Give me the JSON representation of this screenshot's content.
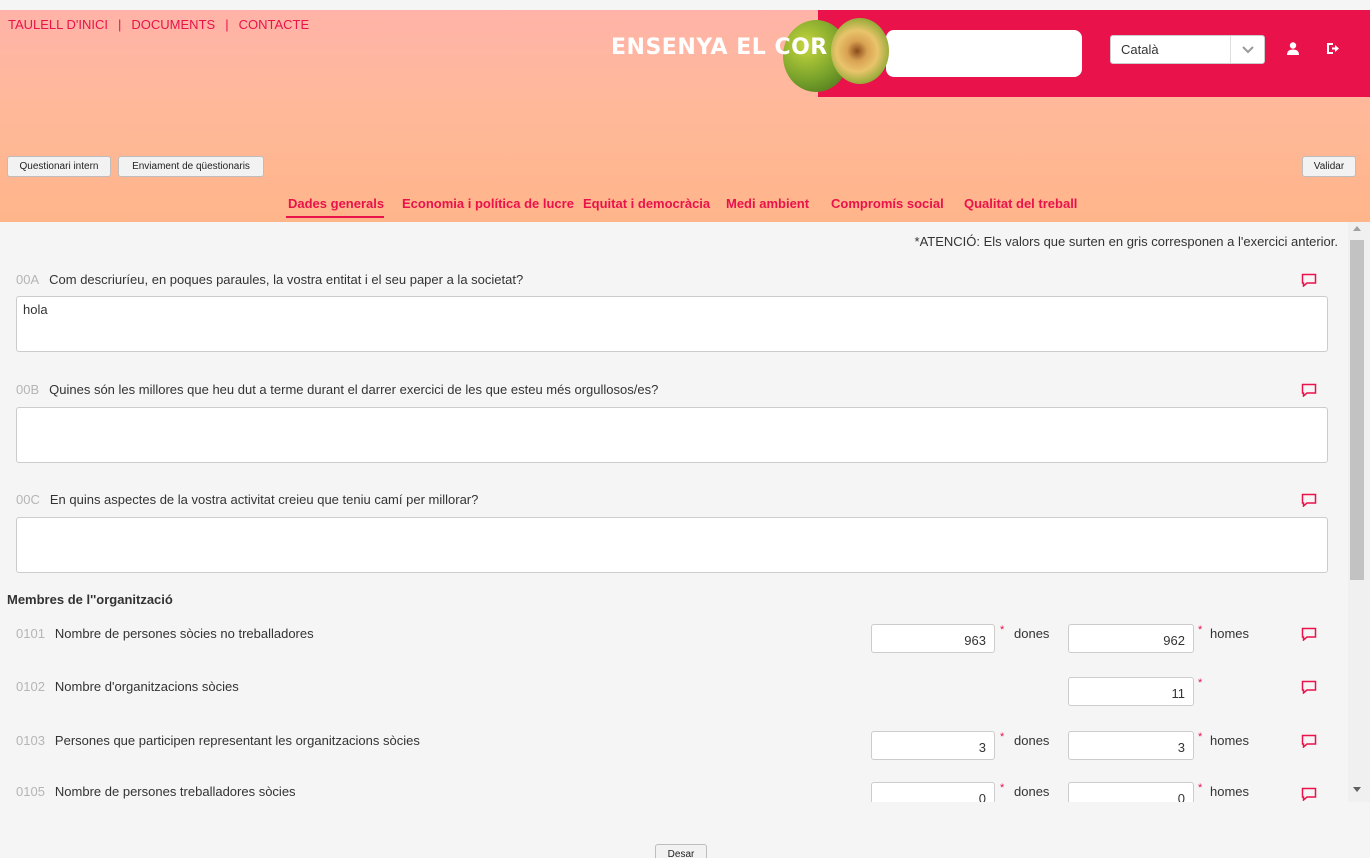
{
  "nav": {
    "items": [
      "TAULELL D'INICI",
      "DOCUMENTS",
      "CONTACTE"
    ],
    "separator": "|"
  },
  "header": {
    "logo_text": "ENSENYA EL COR",
    "language": "Català"
  },
  "toolbar": {
    "internal_questionnaire": "Questionari intern",
    "send_questionnaires": "Enviament de qüestionaris",
    "validate": "Validar"
  },
  "tabs": [
    "Dades generals",
    "Economia i política de lucre",
    "Equitat i democràcia",
    "Medi ambient",
    "Compromís social",
    "Qualitat del treball"
  ],
  "note": "*ATENCIÓ: Els valors que surten en gris corresponen a l'exercici anterior.",
  "questions": [
    {
      "code": "00A",
      "text": "Com descriuríeu, en poques paraules, la vostra entitat i el seu paper a la societat?",
      "answer": "hola"
    },
    {
      "code": "00B",
      "text": "Quines són les millores que heu dut a terme durant el darrer exercici de les que esteu més orgullosos/es?",
      "answer": ""
    },
    {
      "code": "00C",
      "text": "En quins aspectes de la vostra activitat creieu que teniu camí per millorar?",
      "answer": ""
    }
  ],
  "members": {
    "title": "Membres de l''organització",
    "required_mark": "*",
    "unit_women": "dones",
    "unit_men": "homes",
    "rows": [
      {
        "code": "0101",
        "text": "Nombre de persones sòcies no treballadores",
        "women": "963",
        "men": "962"
      },
      {
        "code": "0102",
        "text": "Nombre d'organitzacions sòcies",
        "single": "11"
      },
      {
        "code": "0103",
        "text": "Persones que participen representant les organitzacions sòcies",
        "women": "3",
        "men": "3"
      },
      {
        "code": "0105",
        "text": "Nombre de persones treballadores sòcies",
        "women": "0",
        "men": "0"
      }
    ]
  },
  "footer": {
    "save": "Desar"
  },
  "colors": {
    "accent": "#e9124b",
    "header_bg": "#ffb58a"
  },
  "icons": [
    "user-icon",
    "logout-icon",
    "chevron-down-icon",
    "comment-icon"
  ]
}
